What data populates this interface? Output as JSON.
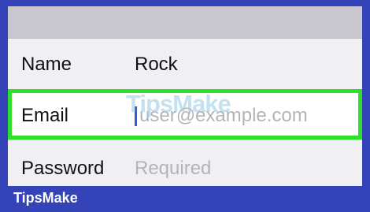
{
  "form": {
    "name": {
      "label": "Name",
      "value": "Rock"
    },
    "email": {
      "label": "Email",
      "placeholder": "user@example.com",
      "value": ""
    },
    "password": {
      "label": "Password",
      "placeholder": "Required"
    }
  },
  "watermark": "TipsMake",
  "brand": "TipsMake",
  "colors": {
    "highlight": "#2fe02a",
    "frame": "#3543b8",
    "caret": "#2b5bd8"
  }
}
